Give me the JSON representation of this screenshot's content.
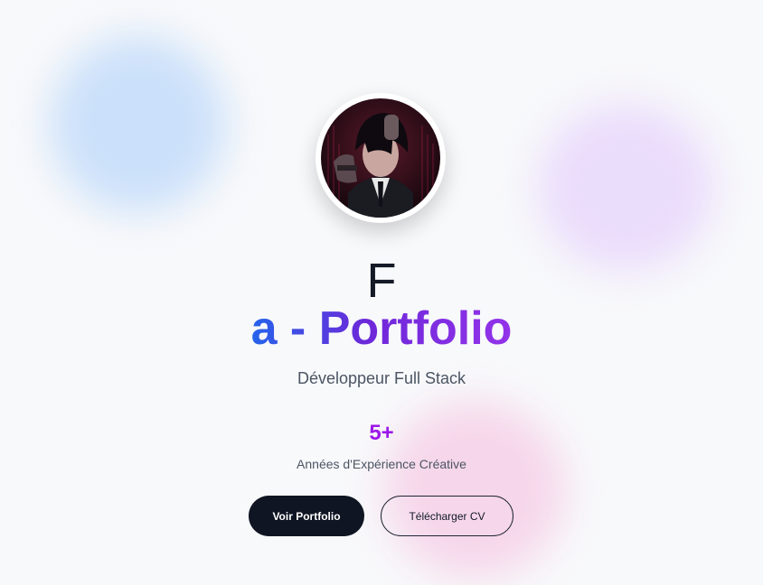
{
  "hero": {
    "name_line1": "F",
    "name_line2": "a - Portfolio",
    "role": "Développeur Full Stack",
    "stat": {
      "value": "5+",
      "label": "Années d'Expérience Créative"
    },
    "buttons": {
      "primary_label": "Voir Portfolio",
      "secondary_label": "Télécharger CV"
    },
    "avatar_icon": "profile-avatar"
  },
  "colors": {
    "background": "#f8f9fb",
    "gradient_start": "#2563eb",
    "gradient_end": "#9333ea",
    "stat_accent": "#9b17e8",
    "primary_button": "#0f1522",
    "blob_blue": "#cbe0fa",
    "blob_purple": "#eadcfb",
    "blob_pink": "#f6d6ea"
  }
}
